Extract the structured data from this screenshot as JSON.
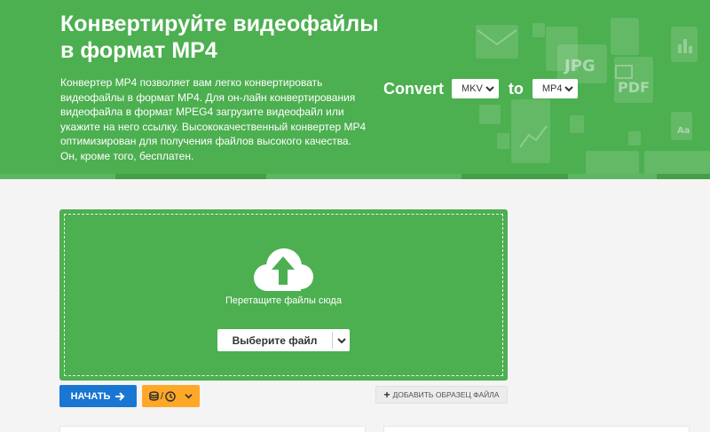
{
  "hero": {
    "title_line1": "Конвертируйте видеофайлы",
    "title_line2": "в формат MP4",
    "description": "Конвертер MP4 позволяет вам легко конвертировать видеофайлы в формат MP4. Для он-лайн конвертирования видеофайла в формат MPEG4 загрузите видеофайл или укажите на него ссылку. Высококачественный конвертер MP4 оптимизирован для получения файлов высокого качества. Он, кроме того, бесплатен.",
    "deco_labels": [
      "JPG",
      "PDF",
      "Aa"
    ]
  },
  "converter": {
    "convert_label": "Convert",
    "to_label": "to",
    "from_format": "MKV",
    "to_format": "MP4"
  },
  "upload": {
    "drop_text": "Перетащите файлы сюда",
    "choose_label": "Выберите файл"
  },
  "actions": {
    "start_label": "НАЧАТЬ",
    "options_separator": "/",
    "sample_label": "ДОБАВИТЬ ОБРАЗЕЦ ФАЙЛА"
  },
  "colors": {
    "brand_green": "#4caf50",
    "primary_blue": "#1976d2",
    "options_orange": "#ffa726"
  },
  "icons": {
    "upload": "cloud-upload-icon",
    "start": "arrow-right-icon",
    "storage": "database-icon",
    "schedule": "clock-icon",
    "expand": "chevron-down-icon",
    "add": "plus-icon"
  }
}
